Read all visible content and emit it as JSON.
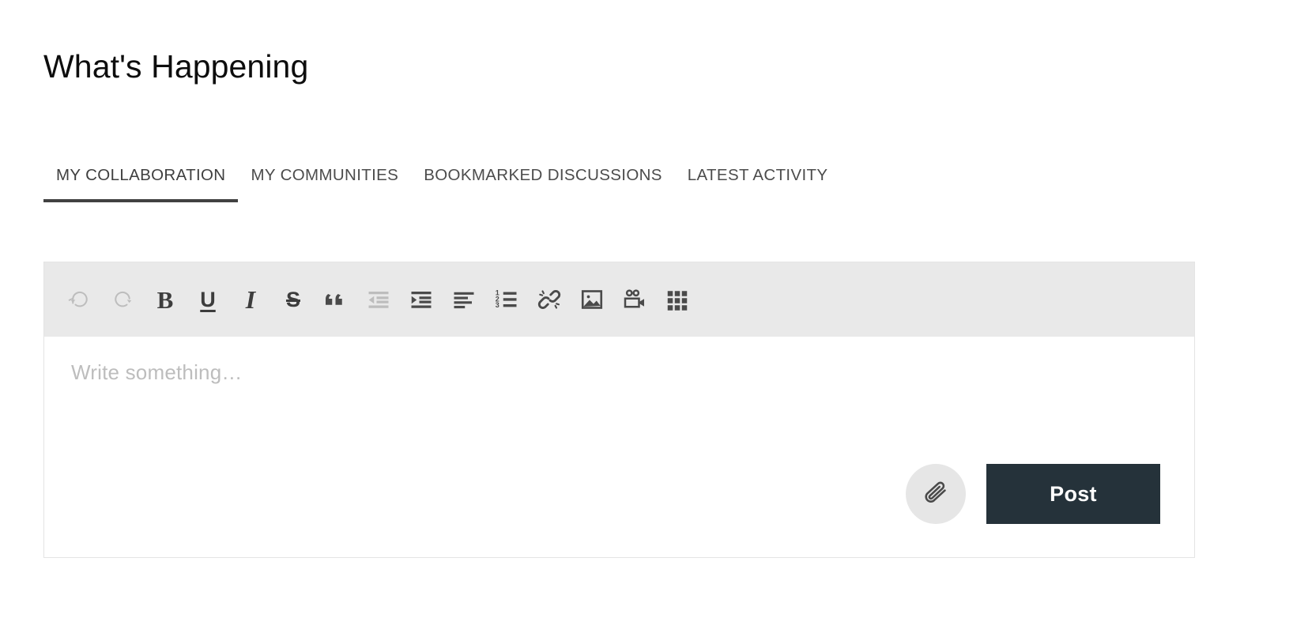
{
  "page": {
    "title": "What's Happening"
  },
  "tabs": {
    "active_index": 0,
    "items": [
      {
        "label": "MY COLLABORATION",
        "name": "tab-my-collaboration"
      },
      {
        "label": "MY COMMUNITIES",
        "name": "tab-my-communities"
      },
      {
        "label": "BOOKMARKED DISCUSSIONS",
        "name": "tab-bookmarked-discussions"
      },
      {
        "label": "LATEST ACTIVITY",
        "name": "tab-latest-activity"
      }
    ]
  },
  "editor": {
    "toolbar": {
      "items": [
        {
          "icon": "undo-icon",
          "label": "Undo",
          "disabled": true
        },
        {
          "icon": "redo-icon",
          "label": "Redo",
          "disabled": true
        },
        {
          "icon": "bold-icon",
          "label": "Bold",
          "glyph": "B"
        },
        {
          "icon": "underline-icon",
          "label": "Underline",
          "glyph": "U"
        },
        {
          "icon": "italic-icon",
          "label": "Italic",
          "glyph": "I"
        },
        {
          "icon": "strikethrough-icon",
          "label": "Strikethrough",
          "glyph": "S"
        },
        {
          "icon": "blockquote-icon",
          "label": "Blockquote"
        },
        {
          "icon": "outdent-icon",
          "label": "Decrease indent",
          "disabled": true
        },
        {
          "icon": "indent-icon",
          "label": "Increase indent"
        },
        {
          "icon": "align-left-icon",
          "label": "Align left"
        },
        {
          "icon": "ordered-list-icon",
          "label": "Numbered list"
        },
        {
          "icon": "link-icon",
          "label": "Insert link"
        },
        {
          "icon": "image-icon",
          "label": "Insert image"
        },
        {
          "icon": "video-icon",
          "label": "Insert video"
        },
        {
          "icon": "table-icon",
          "label": "Insert table"
        }
      ]
    },
    "compose": {
      "placeholder": "Write something…",
      "value": ""
    },
    "actions": {
      "attach_icon": "paperclip-icon",
      "attach_label": "Attach file",
      "post_label": "Post"
    }
  },
  "colors": {
    "post_button": "#25323a",
    "toolbar_background": "#e9e9e9",
    "active_tab_underline": "#424242",
    "tab_text": "#4c4c4c",
    "placeholder_text": "#bdbdbd",
    "attach_circle": "#e6e6e6",
    "editor_border": "#e4e4e4",
    "icon_enabled": "#4a4a4a",
    "icon_disabled": "#bdbdbd"
  }
}
